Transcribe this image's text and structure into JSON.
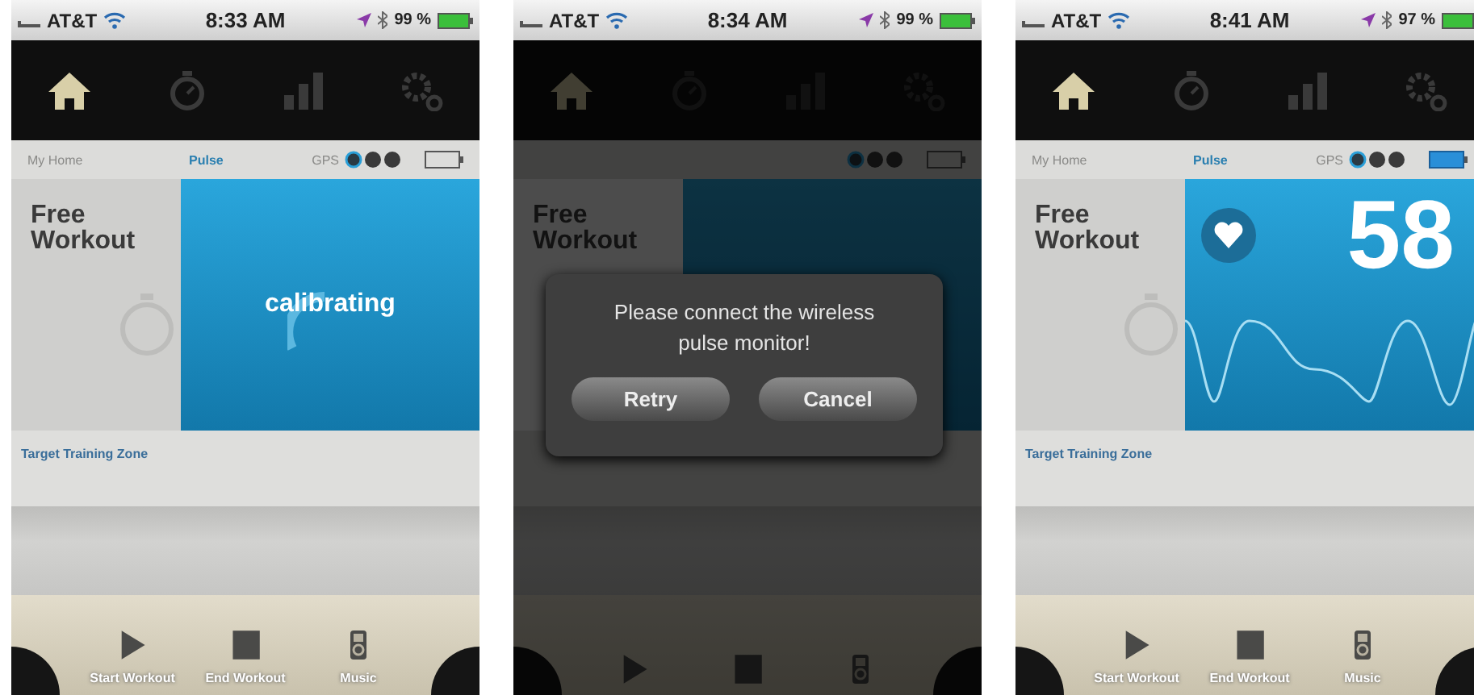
{
  "phones": [
    {
      "status": {
        "carrier": "AT&T",
        "time": "8:33 AM",
        "battery": "99 %"
      },
      "tabs": [
        {
          "selected": true
        },
        {
          "selected": false
        },
        {
          "selected": false
        },
        {
          "selected": false
        }
      ],
      "breadcrumb": {
        "home": "My Home",
        "current": "Pulse",
        "gps": "GPS",
        "sensor_connected": false
      },
      "workout": "Free Workout",
      "panel": {
        "kind": "calibrating",
        "text": "calibrating"
      },
      "zone": "Target Training Zone",
      "toolbar": [
        "Start Workout",
        "End Workout",
        "Music"
      ]
    },
    {
      "status": {
        "carrier": "AT&T",
        "time": "8:34 AM",
        "battery": "99 %"
      },
      "tabs": [
        {
          "selected": true
        },
        {
          "selected": false
        },
        {
          "selected": false
        },
        {
          "selected": false
        }
      ],
      "breadcrumb": {
        "sensor_connected": false
      },
      "workout": "Free Workout",
      "panel": {
        "kind": "blank"
      },
      "dialog": {
        "message": "Please connect the wireless pulse monitor!",
        "buttons": [
          "Retry",
          "Cancel"
        ]
      }
    },
    {
      "status": {
        "carrier": "AT&T",
        "time": "8:41 AM",
        "battery": "97 %"
      },
      "tabs": [
        {
          "selected": true
        },
        {
          "selected": false
        },
        {
          "selected": false
        },
        {
          "selected": false
        }
      ],
      "breadcrumb": {
        "home": "My Home",
        "current": "Pulse",
        "gps": "GPS",
        "sensor_connected": true
      },
      "workout": "Free Workout",
      "panel": {
        "kind": "pulse",
        "value": "58"
      },
      "zone": "Target Training Zone",
      "toolbar": [
        "Start Workout",
        "End Workout",
        "Music"
      ]
    }
  ]
}
